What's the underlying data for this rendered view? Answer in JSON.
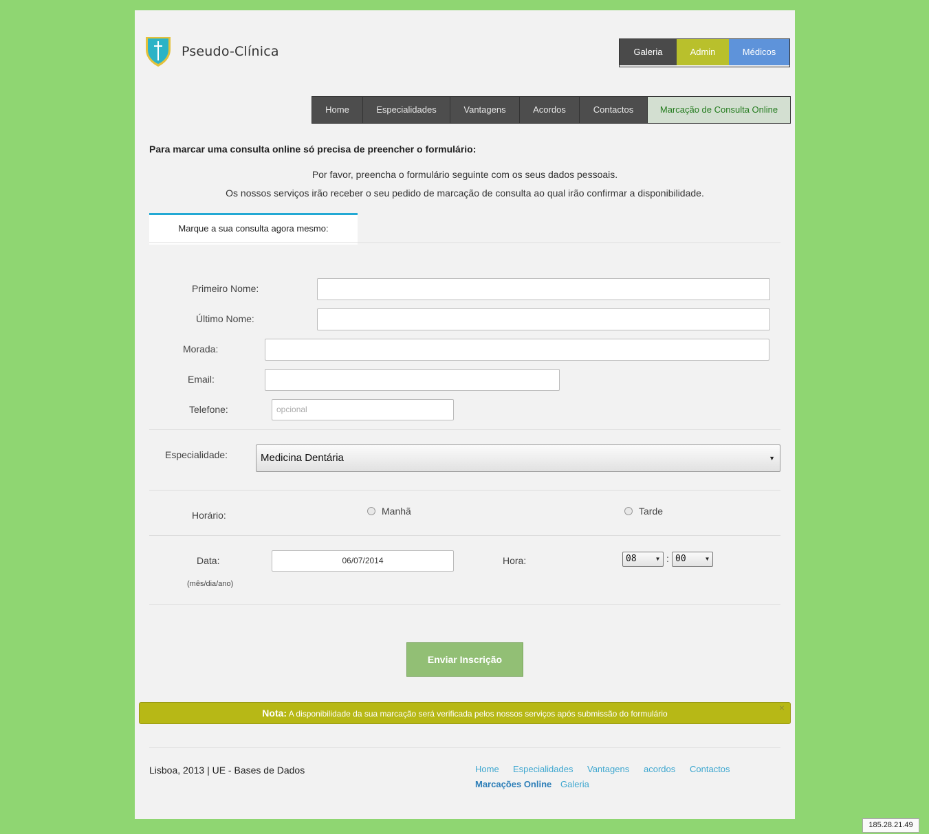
{
  "header": {
    "brand": "Pseudo-Clínica",
    "top_buttons": {
      "galeria": "Galeria",
      "admin": "Admin",
      "medicos": "Médicos"
    },
    "nav": [
      "Home",
      "Especialidades",
      "Vantagens",
      "Acordos",
      "Contactos",
      "Marcação de Consulta Online"
    ]
  },
  "colors": {
    "background": "#8fd672",
    "accent_tab": "#23a9d4",
    "admin": "#b9c02c",
    "medicos": "#5e93da",
    "note": "#b7b816",
    "submit": "#92bf75"
  },
  "content": {
    "title": "Para marcar uma consulta online só precisa de preencher o formulário:",
    "intro1": "Por favor, preencha o formulário seguinte com os seus dados pessoais.",
    "intro2": "Os nossos serviços irão receber o seu pedido de marcação de consulta ao qual irão confirmar a disponibilidade.",
    "tab": "Marque a sua consulta agora mesmo:"
  },
  "form": {
    "first_name_label": "Primeiro Nome:",
    "last_name_label": "Último Nome:",
    "address_label": "Morada:",
    "email_label": "Email:",
    "phone_label": "Telefone:",
    "phone_placeholder": "opcional",
    "specialty_label": "Especialidade:",
    "specialty_value": "Medicina Dentária",
    "schedule_label": "Horário:",
    "morning": "Manhã",
    "afternoon": "Tarde",
    "date_label": "Data:",
    "date_hint": "(mês/dia/ano)",
    "date_value": "06/07/2014",
    "time_label": "Hora:",
    "hour": "08",
    "minute": "00",
    "time_separator": ":",
    "submit": "Enviar Inscrição"
  },
  "note": {
    "label": "Nota:",
    "text": " A disponibilidade da sua marcação será verificada pelos nossos serviços após submissão do formulário",
    "close": "×"
  },
  "footer": {
    "left": "Lisboa, 2013 | UE - Bases de Dados",
    "links": [
      "Home",
      "Especialidades",
      "Vantagens",
      "acordos",
      "Contactos",
      "Marcações Online",
      "Galeria"
    ]
  },
  "ip": "185.28.21.49"
}
